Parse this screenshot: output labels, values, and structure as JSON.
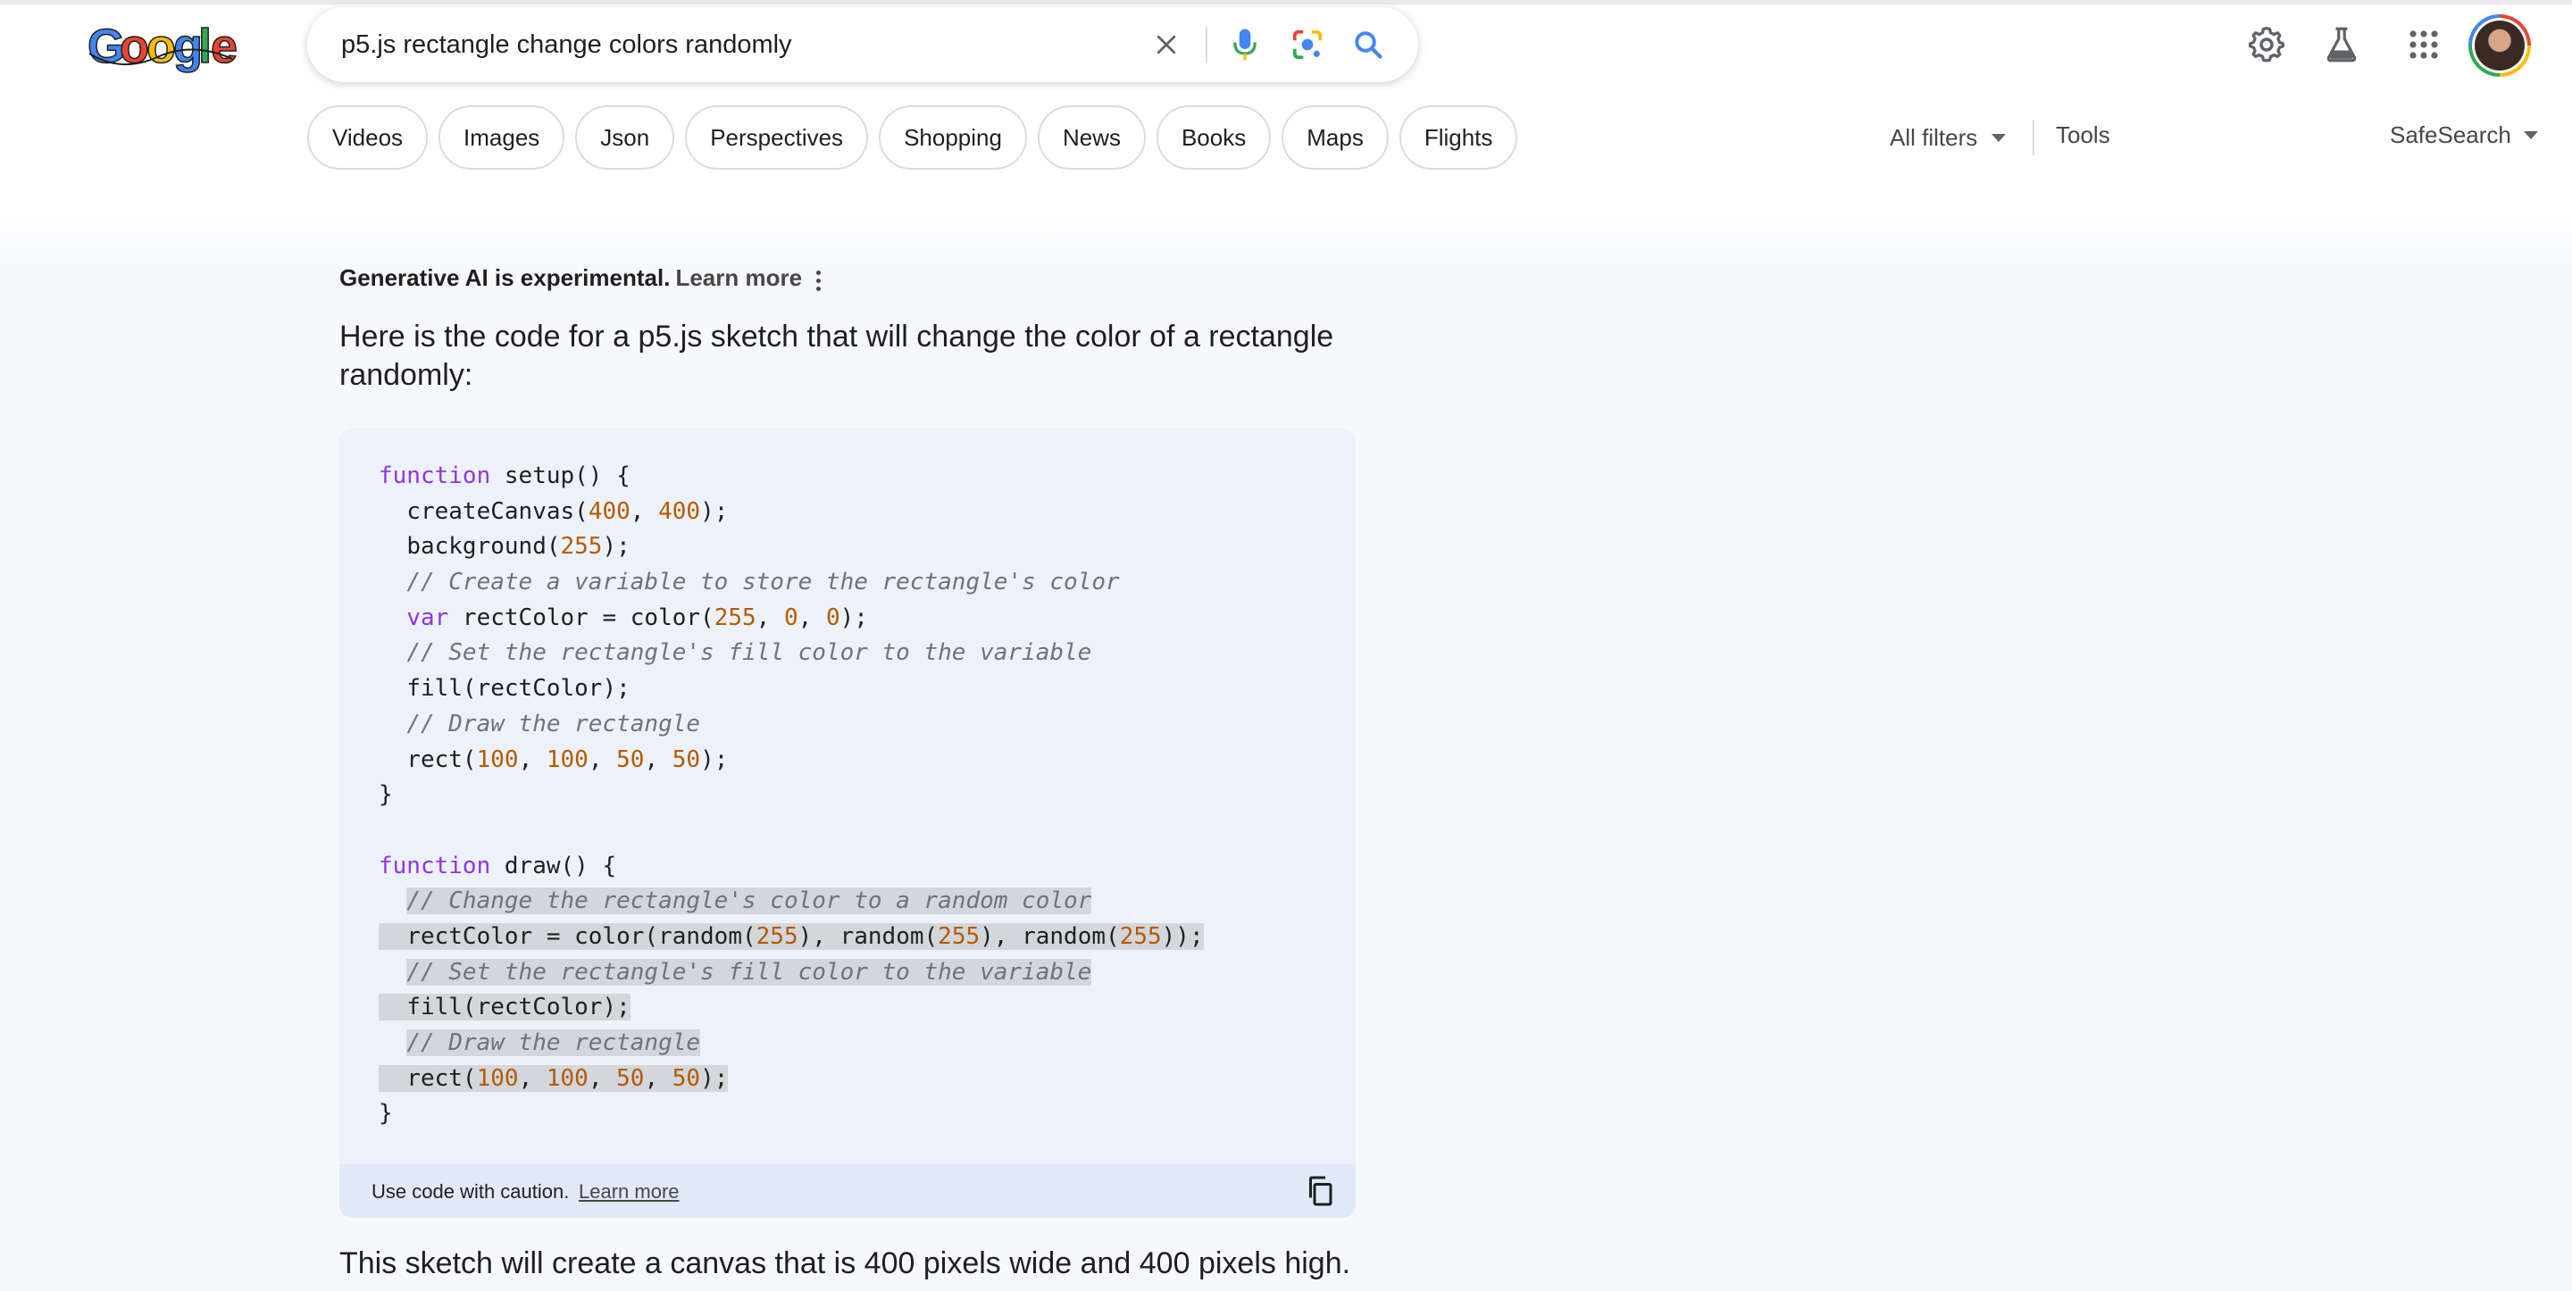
{
  "header": {
    "logo_text": "Google",
    "search_query": "p5.js rectangle change colors randomly",
    "icons": [
      "clear-icon",
      "microphone-icon",
      "lens-icon",
      "search-icon",
      "settings-icon",
      "labs-icon",
      "apps-icon",
      "avatar"
    ]
  },
  "chips": [
    {
      "label": "Videos"
    },
    {
      "label": "Images"
    },
    {
      "label": "Json"
    },
    {
      "label": "Perspectives"
    },
    {
      "label": "Shopping"
    },
    {
      "label": "News"
    },
    {
      "label": "Books"
    },
    {
      "label": "Maps"
    },
    {
      "label": "Flights"
    }
  ],
  "toolbar": {
    "all_filters": "All filters",
    "tools": "Tools",
    "safesearch": "SafeSearch"
  },
  "ai": {
    "experimental": "Generative AI is experimental.",
    "learn_more": "Learn more",
    "intro": "Here is the code for a p5.js sketch that will change the color of a rectangle randomly:",
    "code_lines": [
      "function setup() {",
      "  createCanvas(400, 400);",
      "  background(255);",
      "  // Create a variable to store the rectangle's color",
      "  var rectColor = color(255, 0, 0);",
      "  // Set the rectangle's fill color to the variable",
      "  fill(rectColor);",
      "  // Draw the rectangle",
      "  rect(100, 100, 50, 50);",
      "}",
      "",
      "function draw() {",
      "  // Change the rectangle's color to a random color",
      "  rectColor = color(random(255), random(255), random(255));",
      "  // Set the rectangle's fill color to the variable",
      "  fill(rectColor);",
      "  // Draw the rectangle",
      "  rect(100, 100, 50, 50);",
      "}"
    ],
    "highlighted_lines": [
      12,
      13,
      14,
      15,
      16,
      17
    ],
    "caution": "Use code with caution.",
    "caution_learn_more": "Learn more",
    "summary": "This sketch will create a canvas that is 400 pixels wide and 400 pixels high."
  },
  "colors": {
    "keyword": "#9334e6",
    "number": "#b55a00",
    "comment": "#6f7377",
    "google_blue": "#4285f4",
    "google_red": "#ea4335",
    "google_yellow": "#fbbc05",
    "google_green": "#34a853"
  }
}
